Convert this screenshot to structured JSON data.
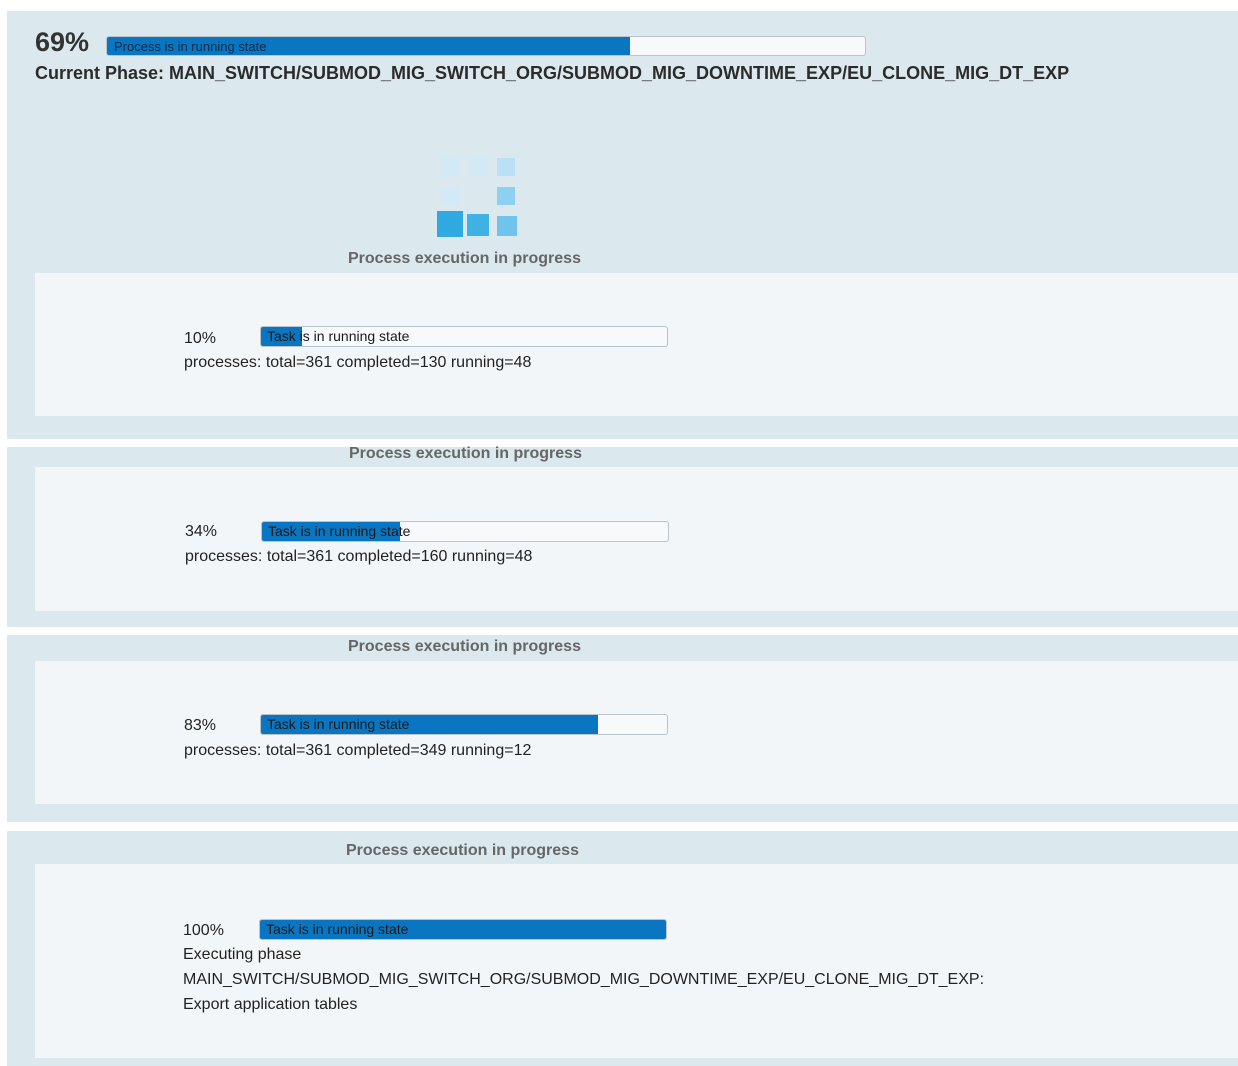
{
  "main": {
    "percent": "69%",
    "bar_text": "Process is in running state",
    "progress": 0.69,
    "current_phase": "Current Phase: MAIN_SWITCH/SUBMOD_MIG_SWITCH_ORG/SUBMOD_MIG_DOWNTIME_EXP/EU_CLONE_MIG_DT_EXP"
  },
  "spinner_icon": "loading-squares-icon",
  "colors": {
    "accent": "#0a76c1",
    "panel": "#dbe9ef",
    "box": "#f3f6f8",
    "muted_label": "#666666"
  },
  "snapshots": [
    {
      "label": "Process execution in progress",
      "percent": "10%",
      "bar_text": "Task is in running state",
      "progress": 0.1,
      "processes": "processes: total=361 completed=130 running=48"
    },
    {
      "label": "Process execution in progress",
      "percent": "34%",
      "bar_text": "Task is in running state",
      "progress": 0.34,
      "processes": "processes: total=361 completed=160 running=48"
    },
    {
      "label": "Process execution in progress",
      "percent": "83%",
      "bar_text": "Task is in running state",
      "progress": 0.83,
      "processes": "processes: total=361 completed=349 running=12"
    },
    {
      "label": "Process execution in progress",
      "percent": "100%",
      "bar_text": "Task is in running state",
      "progress": 1.0,
      "executing_line1": "Executing phase",
      "executing_line2": "MAIN_SWITCH/SUBMOD_MIG_SWITCH_ORG/SUBMOD_MIG_DOWNTIME_EXP/EU_CLONE_MIG_DT_EXP:",
      "executing_line3": "Export application tables"
    }
  ]
}
